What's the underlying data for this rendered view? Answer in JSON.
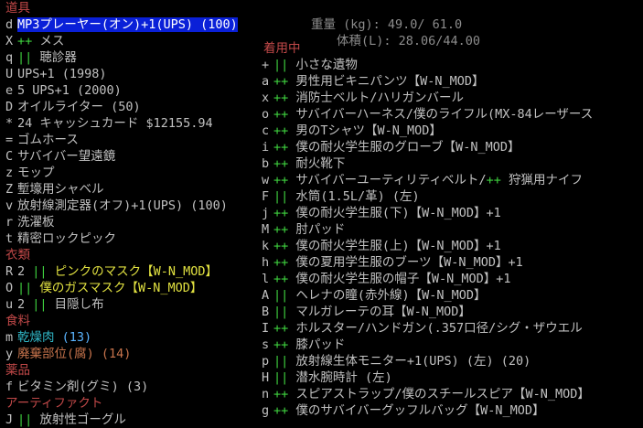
{
  "stats": {
    "weight": "重量 (kg):   49.0/ 61.0",
    "volume": "体積(L):  28.06/44.00"
  },
  "inventory": {
    "header": "道具",
    "items_tools": [
      {
        "key": "d",
        "pre": "",
        "name": "MP3プレーヤー(オン)+1(UPS) (100)",
        "sel": true
      },
      {
        "key": "X",
        "pre": "++",
        "name": " メス"
      },
      {
        "key": "q",
        "pre": "||",
        "name": " 聴診器"
      },
      {
        "key": "U",
        "pre": "",
        "name": "UPS+1 (1998)"
      },
      {
        "key": "e",
        "pre": "",
        "name": "5 UPS+1 (2000)"
      },
      {
        "key": "D",
        "pre": "",
        "name": "オイルライター (50)"
      },
      {
        "key": "*",
        "pre": "",
        "name": "24 キャッシュカード $12155.94"
      },
      {
        "key": "=",
        "pre": "",
        "name": "ゴムホース"
      },
      {
        "key": "C",
        "pre": "",
        "name": "サバイバー望遠鏡"
      },
      {
        "key": "z",
        "pre": "",
        "name": "モップ"
      },
      {
        "key": "Z",
        "pre": "",
        "name": "塹壕用シャベル"
      },
      {
        "key": "v",
        "pre": "",
        "name": "放射線測定器(オフ)+1(UPS) (100)"
      },
      {
        "key": "r",
        "pre": "",
        "name": "洗濯板"
      },
      {
        "key": "t",
        "pre": "",
        "name": "精密ロックピック"
      }
    ],
    "header_clothing": "衣類",
    "items_clothing": [
      {
        "key": "R",
        "pre": "2 ",
        "mid": "||",
        "name": " ピンクのマスク【W-N_MOD】"
      },
      {
        "key": "O",
        "pre": "",
        "mid": "||",
        "name": " 僕のガスマスク【W-N_MOD】"
      },
      {
        "key": "u",
        "pre": "2 ",
        "mid": "||",
        "name": " 目隠し布"
      }
    ],
    "header_food": "食料",
    "items_food": [
      {
        "key": "m",
        "name": "乾燥肉",
        "extra": " (13)"
      },
      {
        "key": "y",
        "name": "廃棄部位(腐)",
        "extra": " (14)"
      }
    ],
    "header_meds": "薬品",
    "items_meds": [
      {
        "key": "f",
        "name": "ビタミン剤(グミ) (3)"
      }
    ],
    "header_artifact": "アーティファクト",
    "items_artifact": [
      {
        "key": "J",
        "mid": "||",
        "name": " 放射性ゴーグル"
      }
    ]
  },
  "worn": {
    "header": "着用中",
    "items": [
      {
        "key": "+",
        "mid": "||",
        "name": " 小さな遺物"
      },
      {
        "key": "a",
        "mid": "++",
        "name": " 男性用ビキニパンツ【W-N_MOD】"
      },
      {
        "key": "x",
        "mid": "++",
        "name": " 消防士ベルト/ハリガンバール"
      },
      {
        "key": "o",
        "mid": "++",
        "name": " サバイバーハーネス/僕のライフル(MX-84レーザース"
      },
      {
        "key": "c",
        "mid": "++",
        "name": " 男のTシャツ【W-N_MOD】"
      },
      {
        "key": "i",
        "mid": "++",
        "name": " 僕の耐火学生服のグローブ【W-N_MOD】"
      },
      {
        "key": "b",
        "mid": "++",
        "name": " 耐火靴下"
      },
      {
        "key": "w",
        "mid": "++",
        "name": " サバイバーユーティリティベルト/",
        "extra": "++",
        "tail": " 狩猟用ナイフ"
      },
      {
        "key": "F",
        "mid": "||",
        "name": " 水筒(1.5L/革) (左)"
      },
      {
        "key": "j",
        "mid": "++",
        "name": " 僕の耐火学生服(下)【W-N_MOD】+1"
      },
      {
        "key": "M",
        "mid": "++",
        "name": " 肘パッド"
      },
      {
        "key": "k",
        "mid": "++",
        "name": " 僕の耐火学生服(上)【W-N_MOD】+1"
      },
      {
        "key": "h",
        "mid": "++",
        "name": " 僕の夏用学生服のブーツ【W-N_MOD】+1"
      },
      {
        "key": "l",
        "mid": "++",
        "name": " 僕の耐火学生服の帽子【W-N_MOD】+1"
      },
      {
        "key": "A",
        "mid": "||",
        "name": " ヘレナの瞳(赤外線)【W-N_MOD】"
      },
      {
        "key": "B",
        "mid": "||",
        "name": " マルガレーテの耳【W-N_MOD】"
      },
      {
        "key": "I",
        "mid": "++",
        "name": " ホルスター/ハンドガン(.357口径/シグ・ザウエル"
      },
      {
        "key": "s",
        "mid": "++",
        "name": " 膝パッド"
      },
      {
        "key": "p",
        "mid": "||",
        "name": " 放射線生体モニター+1(UPS) (左) (20)"
      },
      {
        "key": "H",
        "mid": "||",
        "name": " 潜水腕時計 (左)"
      },
      {
        "key": "n",
        "mid": "++",
        "name": " スピアストラップ/僕のスチールスピア【W-N_MOD】"
      },
      {
        "key": "g",
        "mid": "++",
        "name": " 僕のサバイバーグッフルバッグ【W-N_MOD】"
      }
    ]
  },
  "colors": {
    "background": "#000000",
    "category": "#c04848",
    "selection": "#0a20d8",
    "marker_green": "#3fd23f",
    "mask_yellow": "#e0e040",
    "food_cyan": "#30b8c8",
    "rotten_orange": "#c8744c"
  }
}
